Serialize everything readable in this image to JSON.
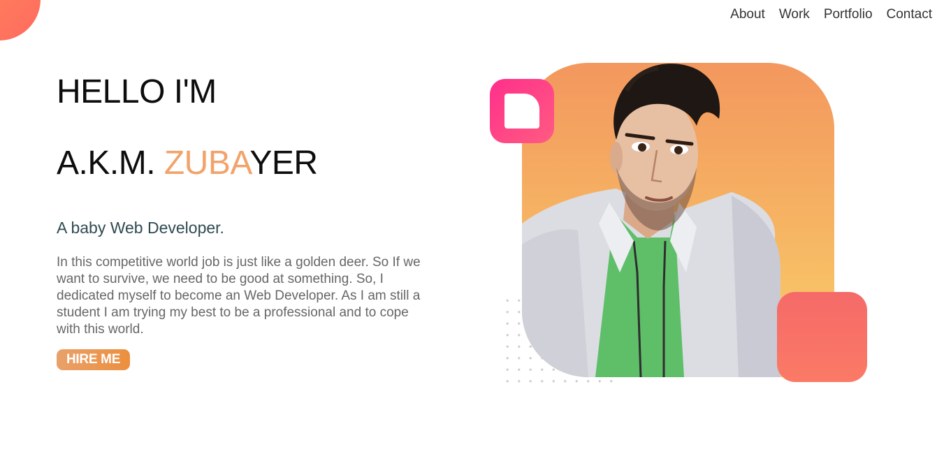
{
  "nav": {
    "items": [
      {
        "label": "About"
      },
      {
        "label": "Work"
      },
      {
        "label": "Portfolio"
      },
      {
        "label": "Contact"
      }
    ]
  },
  "hero": {
    "greeting": "HELLO I'M",
    "name_prefix": "A.K.M. ",
    "name_highlight": "ZUBA",
    "name_suffix": "YER",
    "role": "A baby Web Developer.",
    "bio": "In this competitive world job is just like a golden deer. So If we want to survive, we need to be good at something. So, I dedicated myself to become an Web Developer. As I am still a student I am trying my best to be a professional and to cope with this world.",
    "cta_label": "HIRE ME"
  },
  "colors": {
    "accent": "#f2a36b",
    "cta_gradient_start": "#e9a16a",
    "cta_gradient_end": "#ec8f3e",
    "pink_shape": "#ff2f8b",
    "coral_shape": "#f56a68",
    "photo_gradient_top": "#f3975e",
    "photo_gradient_bottom": "#fbd16a"
  },
  "icons": {
    "corner": "gradient-circle",
    "frame": "rounded-square-outline",
    "dots": "dot-grid-pattern"
  }
}
